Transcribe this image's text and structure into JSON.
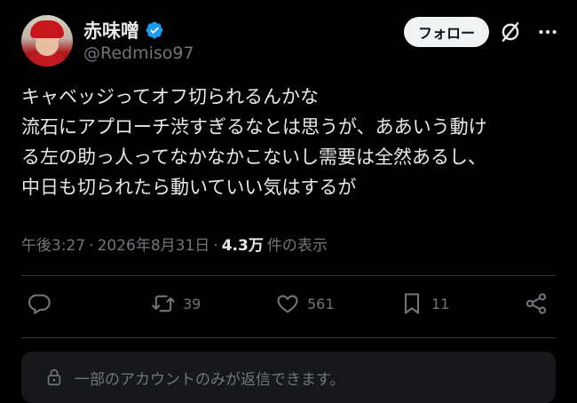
{
  "author": {
    "name": "赤味噌",
    "handle": "@Redmiso97",
    "verified": true
  },
  "follow_label": "フォロー",
  "tweet": {
    "text": "キャベッジってオフ切られるんかな\n流石にアプローチ渋すぎるなとは思うが、ああいう動け\nる左の助っ人ってなかなかこないし需要は全然あるし、\n中日も切られたら動いていい気はするが",
    "time": "午後3:27",
    "date": "2026年8月31日",
    "views": "4.3万",
    "views_label": "件の表示"
  },
  "actions": {
    "reply_icon": "reply-icon",
    "retweet_count": "39",
    "like_count": "561",
    "bookmark_count": "11",
    "share_icon": "share-icon"
  },
  "reply_restriction": "一部のアカウントのみが返信できます。",
  "colors": {
    "background": "#000000",
    "text": "#e7e9ea",
    "muted": "#71767b",
    "verified": "#1d9bf0"
  }
}
